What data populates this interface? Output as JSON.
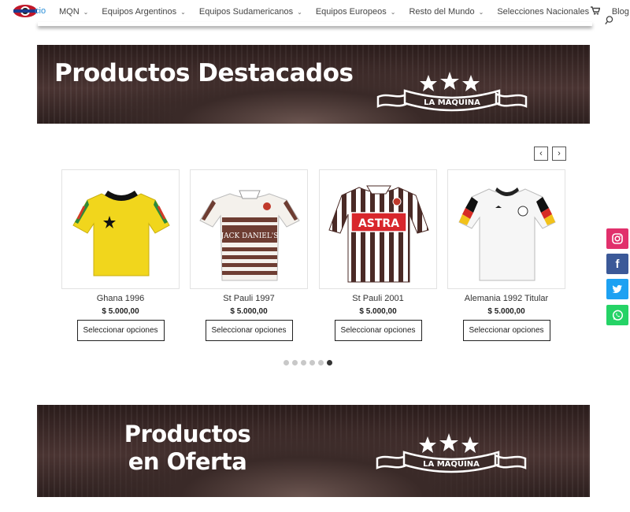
{
  "nav": {
    "logo_text": "cio",
    "items": [
      {
        "label": "MQN"
      },
      {
        "label": "Equipos Argentinos"
      },
      {
        "label": "Equipos Sudamericanos"
      },
      {
        "label": "Equipos Europeos"
      },
      {
        "label": "Resto del Mundo"
      },
      {
        "label": "Selecciones Nacionales"
      },
      {
        "label": "Blog"
      }
    ],
    "cart_icon": "cart-icon",
    "search_icon": "search-icon"
  },
  "banners": [
    {
      "title": "Productos Destacados",
      "emblem_text": "LA MAQUINA"
    },
    {
      "title_line1": "Productos",
      "title_line2": "en Oferta",
      "emblem_text": "LA MAQUINA"
    }
  ],
  "carousel": {
    "prev_icon": "chevron-left-icon",
    "next_icon": "chevron-right-icon",
    "dot_count": 6,
    "active_dot": 6
  },
  "products": [
    {
      "name": "Ghana 1996",
      "price": "$ 5.000,00",
      "button": "Seleccionar opciones"
    },
    {
      "name": "St Pauli 1997",
      "price": "$ 5.000,00",
      "button": "Seleccionar opciones",
      "shirt_text": "JACK DANIEL'S"
    },
    {
      "name": "St Pauli 2001",
      "price": "$ 5.000,00",
      "button": "Seleccionar opciones",
      "shirt_text": "ASTRA"
    },
    {
      "name": "Alemania 1992 Titular",
      "price": "$ 5.000,00",
      "button": "Seleccionar opciones"
    }
  ],
  "social": [
    "instagram-icon",
    "facebook-icon",
    "twitter-icon",
    "whatsapp-icon"
  ],
  "colors": {
    "instagram": "#e1306c",
    "facebook": "#3b5998",
    "twitter": "#1da1f2",
    "whatsapp": "#25d366",
    "banner": "#3a2a28"
  }
}
